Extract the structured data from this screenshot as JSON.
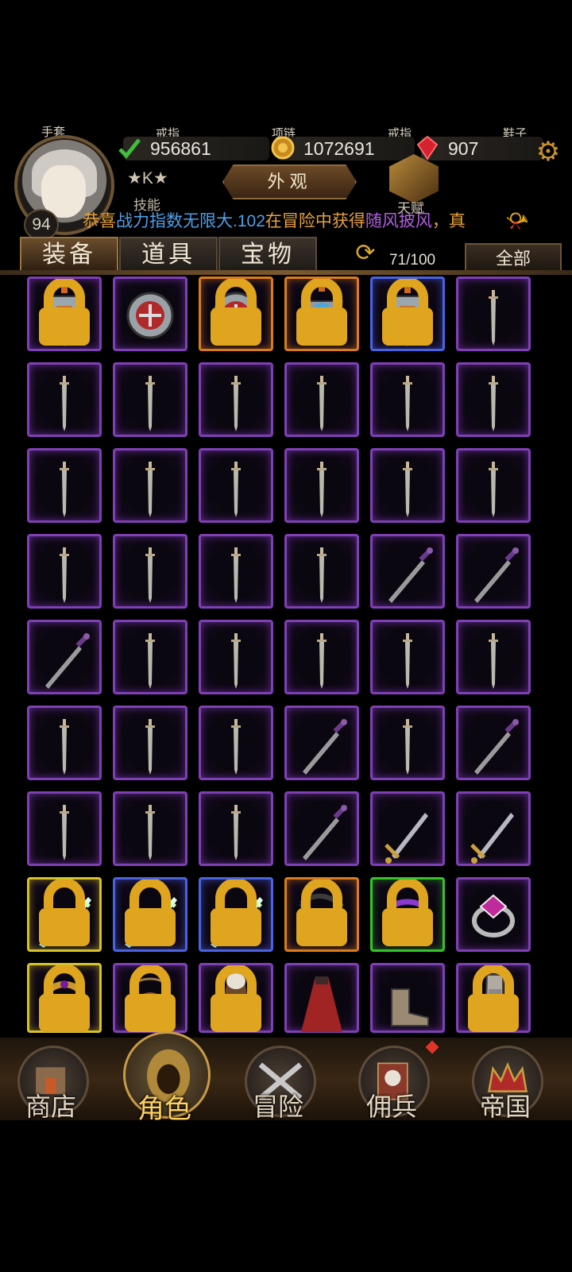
{
  "header": {
    "slot_labels": [
      "手套",
      "戒指",
      "项链",
      "戒指",
      "鞋子"
    ],
    "level": "94",
    "resources": [
      {
        "name": "power",
        "value": "956861",
        "icon": "green-check-icon"
      },
      {
        "name": "gold",
        "value": "1072691",
        "icon": "gold-coin-icon"
      },
      {
        "name": "gem",
        "value": "907",
        "icon": "red-gem-icon"
      }
    ],
    "rank_text": "★K★",
    "appearance_label": "外观",
    "skill_label": "技能",
    "talent_label": "天赋",
    "news": {
      "part1": "恭喜",
      "part2": "战力指数无限大.102",
      "part3": "在冒险中获得",
      "part4": "随风披风",
      "part5": "，真"
    }
  },
  "tabs": [
    "装备",
    "道具",
    "宝物"
  ],
  "active_tab": 0,
  "capacity": "71/100",
  "filter_label": "全部",
  "grid": [
    [
      {
        "icon": "gloves-armor-icon",
        "rarity": "purple",
        "locked": true
      },
      {
        "icon": "ring-crest-icon",
        "rarity": "purple",
        "locked": false
      },
      {
        "icon": "ring-crest-icon",
        "rarity": "orange",
        "locked": true
      },
      {
        "icon": "armor-blue-icon",
        "rarity": "orange",
        "locked": true
      },
      {
        "icon": "gloves-armor-icon",
        "rarity": "blue",
        "locked": true
      },
      {
        "icon": "short-sword-icon",
        "rarity": "purple",
        "locked": false
      }
    ],
    [
      {
        "icon": "short-sword-icon",
        "rarity": "purple",
        "locked": false
      },
      {
        "icon": "short-sword-icon",
        "rarity": "purple",
        "locked": false
      },
      {
        "icon": "short-sword-icon",
        "rarity": "purple",
        "locked": false
      },
      {
        "icon": "short-sword-icon",
        "rarity": "purple",
        "locked": false
      },
      {
        "icon": "short-sword-icon",
        "rarity": "purple",
        "locked": false
      },
      {
        "icon": "short-sword-icon",
        "rarity": "purple",
        "locked": false
      }
    ],
    [
      {
        "icon": "short-sword-icon",
        "rarity": "purple",
        "locked": false
      },
      {
        "icon": "short-sword-icon",
        "rarity": "purple",
        "locked": false
      },
      {
        "icon": "short-sword-icon",
        "rarity": "purple",
        "locked": false
      },
      {
        "icon": "short-sword-icon",
        "rarity": "purple",
        "locked": false
      },
      {
        "icon": "short-sword-icon",
        "rarity": "purple",
        "locked": false
      },
      {
        "icon": "short-sword-icon",
        "rarity": "purple",
        "locked": false
      }
    ],
    [
      {
        "icon": "short-sword-icon",
        "rarity": "purple",
        "locked": false
      },
      {
        "icon": "short-sword-icon",
        "rarity": "purple",
        "locked": false
      },
      {
        "icon": "short-sword-icon",
        "rarity": "purple",
        "locked": false
      },
      {
        "icon": "short-sword-icon",
        "rarity": "purple",
        "locked": false
      },
      {
        "icon": "dark-sword-icon",
        "rarity": "purple",
        "locked": false
      },
      {
        "icon": "dark-sword-icon",
        "rarity": "purple",
        "locked": false
      }
    ],
    [
      {
        "icon": "dark-sword-icon",
        "rarity": "purple",
        "locked": false
      },
      {
        "icon": "short-sword-icon",
        "rarity": "purple",
        "locked": false
      },
      {
        "icon": "short-sword-icon",
        "rarity": "purple",
        "locked": false
      },
      {
        "icon": "short-sword-icon",
        "rarity": "purple",
        "locked": false
      },
      {
        "icon": "short-sword-icon",
        "rarity": "purple",
        "locked": false
      },
      {
        "icon": "short-sword-icon",
        "rarity": "purple",
        "locked": false
      }
    ],
    [
      {
        "icon": "short-sword-icon",
        "rarity": "purple",
        "locked": false
      },
      {
        "icon": "short-sword-icon",
        "rarity": "purple",
        "locked": false
      },
      {
        "icon": "short-sword-icon",
        "rarity": "purple",
        "locked": false
      },
      {
        "icon": "dark-sword-icon",
        "rarity": "purple",
        "locked": false
      },
      {
        "icon": "short-sword-icon",
        "rarity": "purple",
        "locked": false
      },
      {
        "icon": "dark-sword-icon",
        "rarity": "purple",
        "locked": false
      }
    ],
    [
      {
        "icon": "short-sword-icon",
        "rarity": "purple",
        "locked": false
      },
      {
        "icon": "short-sword-icon",
        "rarity": "purple",
        "locked": false
      },
      {
        "icon": "short-sword-icon",
        "rarity": "purple",
        "locked": false
      },
      {
        "icon": "dark-sword-icon",
        "rarity": "purple",
        "locked": false
      },
      {
        "icon": "gold-sword-icon",
        "rarity": "purple",
        "locked": false
      },
      {
        "icon": "gold-sword-icon",
        "rarity": "purple",
        "locked": false
      }
    ],
    [
      {
        "icon": "glowing-sword-icon",
        "rarity": "yellow",
        "locked": true
      },
      {
        "icon": "glowing-sword-icon",
        "rarity": "blue",
        "locked": true
      },
      {
        "icon": "glowing-sword-icon",
        "rarity": "blue",
        "locked": true
      },
      {
        "icon": "amulet-icon",
        "rarity": "orange",
        "locked": true
      },
      {
        "icon": "purple-ring-icon",
        "rarity": "green",
        "locked": true
      },
      {
        "icon": "gem-ring-icon",
        "rarity": "purple",
        "locked": false
      }
    ],
    [
      {
        "icon": "gold-ring-icon",
        "rarity": "yellow",
        "locked": true
      },
      {
        "icon": "necklace-icon",
        "rarity": "purple",
        "locked": true
      },
      {
        "icon": "brown-cloak-icon",
        "rarity": "purple",
        "locked": true
      },
      {
        "icon": "red-cloak-icon",
        "rarity": "purple",
        "locked": false
      },
      {
        "icon": "boots-icon",
        "rarity": "purple",
        "locked": false
      },
      {
        "icon": "armored-boots-icon",
        "rarity": "purple",
        "locked": true
      }
    ]
  ],
  "nav": [
    {
      "label": "商店",
      "icon": "castle-shop-icon",
      "active": false
    },
    {
      "label": "角色",
      "icon": "hooded-character-icon",
      "active": true
    },
    {
      "label": "冒险",
      "icon": "crossed-swords-icon",
      "active": false
    },
    {
      "label": "佣兵",
      "icon": "mercenary-cards-icon",
      "active": false
    },
    {
      "label": "帝国",
      "icon": "crown-icon",
      "active": false
    }
  ],
  "colors": {
    "purple": "#7f3fb5",
    "orange": "#d97c1d",
    "blue": "#4a63e0",
    "yellow": "#d8c22a",
    "green": "#35c22c",
    "news_orange": "#e7a23a",
    "news_blue": "#4f9fe8",
    "news_purple": "#b15ee3"
  }
}
